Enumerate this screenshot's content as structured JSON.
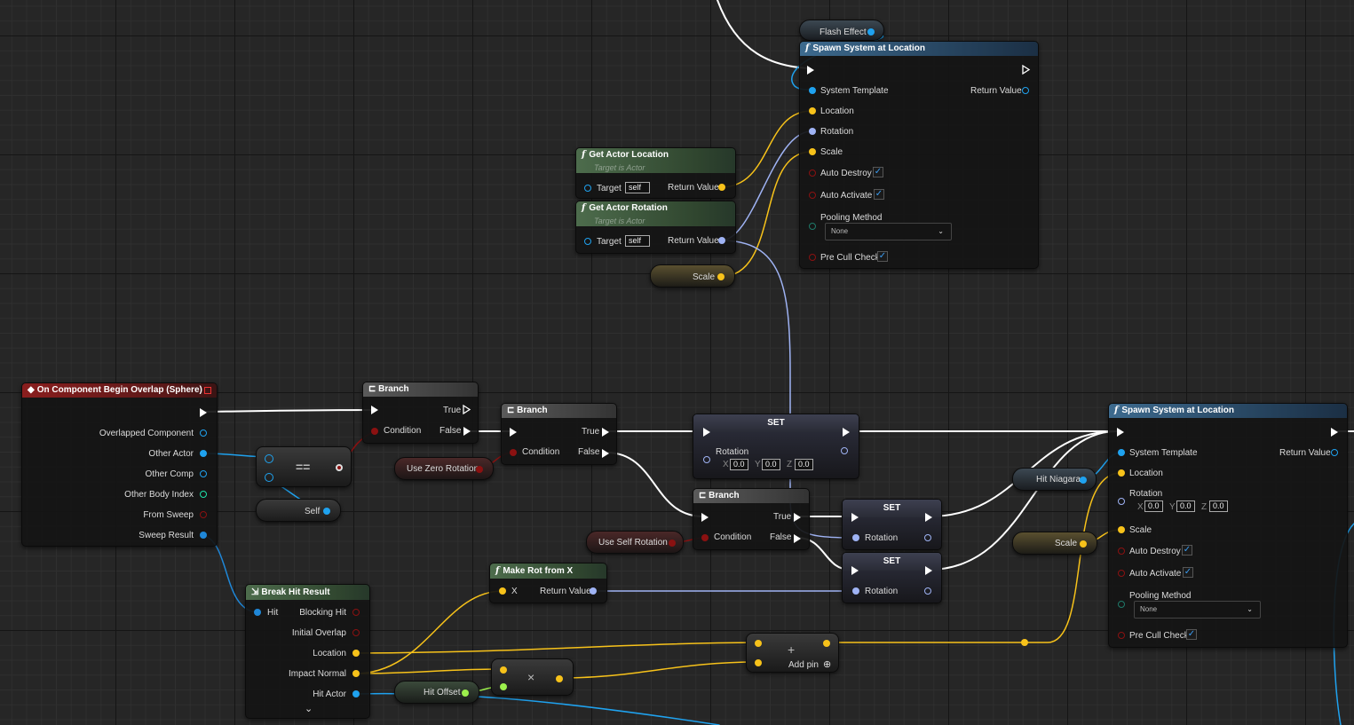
{
  "colors": {
    "exec": "#ffffff",
    "object": "#1fa2ef",
    "vector": "#f7c21a",
    "rotator": "#9fb3f4",
    "bool": "#8b1111",
    "struct": "#1f87d8",
    "int": "#1ee3ab",
    "float": "#9cf04c"
  },
  "spawn_top": {
    "title": "Spawn System at Location",
    "func_icon": "f",
    "pins": {
      "system_template": "System Template",
      "return_value": "Return Value",
      "location": "Location",
      "rotation": "Rotation",
      "scale": "Scale",
      "auto_destroy": "Auto Destroy",
      "auto_activate": "Auto Activate",
      "pooling_method": "Pooling Method",
      "pooling_value": "None",
      "pre_cull_check": "Pre Cull Check"
    },
    "checks": {
      "auto_destroy": true,
      "auto_activate": true,
      "pre_cull": true
    }
  },
  "flash_effect": {
    "label": "Flash Effect"
  },
  "get_actor_location": {
    "title": "Get Actor Location",
    "subtitle": "Target is Actor",
    "target": "Target",
    "target_value": "self",
    "return_value": "Return Value"
  },
  "get_actor_rotation": {
    "title": "Get Actor Rotation",
    "subtitle": "Target is Actor",
    "target": "Target",
    "target_value": "self",
    "return_value": "Return Value"
  },
  "scale_var_top": {
    "label": "Scale"
  },
  "overlap": {
    "title": "On Component Begin Overlap (Sphere)",
    "pins": [
      "Overlapped Component",
      "Other Actor",
      "Other Comp",
      "Other Body Index",
      "From Sweep",
      "Sweep Result"
    ]
  },
  "equal": {
    "label": "=="
  },
  "self_pill": {
    "label": "Self"
  },
  "branch1": {
    "title": "Branch",
    "true": "True",
    "false": "False",
    "condition": "Condition"
  },
  "use_zero_rotation": {
    "label": "Use Zero Rotation"
  },
  "branch2": {
    "title": "Branch",
    "true": "True",
    "false": "False",
    "condition": "Condition"
  },
  "set1": {
    "title": "SET",
    "pin": "Rotation",
    "x": "X",
    "y": "Y",
    "z": "Z",
    "xv": "0.0",
    "yv": "0.0",
    "zv": "0.0"
  },
  "branch3": {
    "title": "Branch",
    "true": "True",
    "false": "False",
    "condition": "Condition"
  },
  "use_self_rotation": {
    "label": "Use Self Rotation"
  },
  "set2": {
    "title": "SET",
    "pin": "Rotation"
  },
  "set3": {
    "title": "SET",
    "pin": "Rotation"
  },
  "break_hit": {
    "title": "Break Hit Result",
    "pins": {
      "hit": "Hit",
      "blocking_hit": "Blocking Hit",
      "initial_overlap": "Initial Overlap",
      "location": "Location",
      "impact_normal": "Impact Normal",
      "hit_actor": "Hit Actor"
    },
    "more": "⌄"
  },
  "make_rot": {
    "title": "Make Rot from X",
    "x": "X",
    "return_value": "Return Value"
  },
  "multiply": {
    "label": "×"
  },
  "hit_offset": {
    "label": "Hit Offset"
  },
  "add": {
    "label": "+",
    "add_pin": "Add pin"
  },
  "hit_niagara": {
    "label": "Hit Niagara"
  },
  "scale_var_bottom": {
    "label": "Scale"
  },
  "spawn_bottom": {
    "title": "Spawn System at Location",
    "func_icon": "f",
    "pins": {
      "system_template": "System Template",
      "return_value": "Return Value",
      "location": "Location",
      "rotation": "Rotation",
      "x": "X",
      "y": "Y",
      "z": "Z",
      "xv": "0.0",
      "yv": "0.0",
      "zv": "0.0",
      "scale": "Scale",
      "auto_destroy": "Auto Destroy",
      "auto_activate": "Auto Activate",
      "pooling_method": "Pooling Method",
      "pooling_value": "None",
      "pre_cull_check": "Pre Cull Check"
    },
    "checks": {
      "auto_destroy": true,
      "auto_activate": true,
      "pre_cull": true
    }
  }
}
